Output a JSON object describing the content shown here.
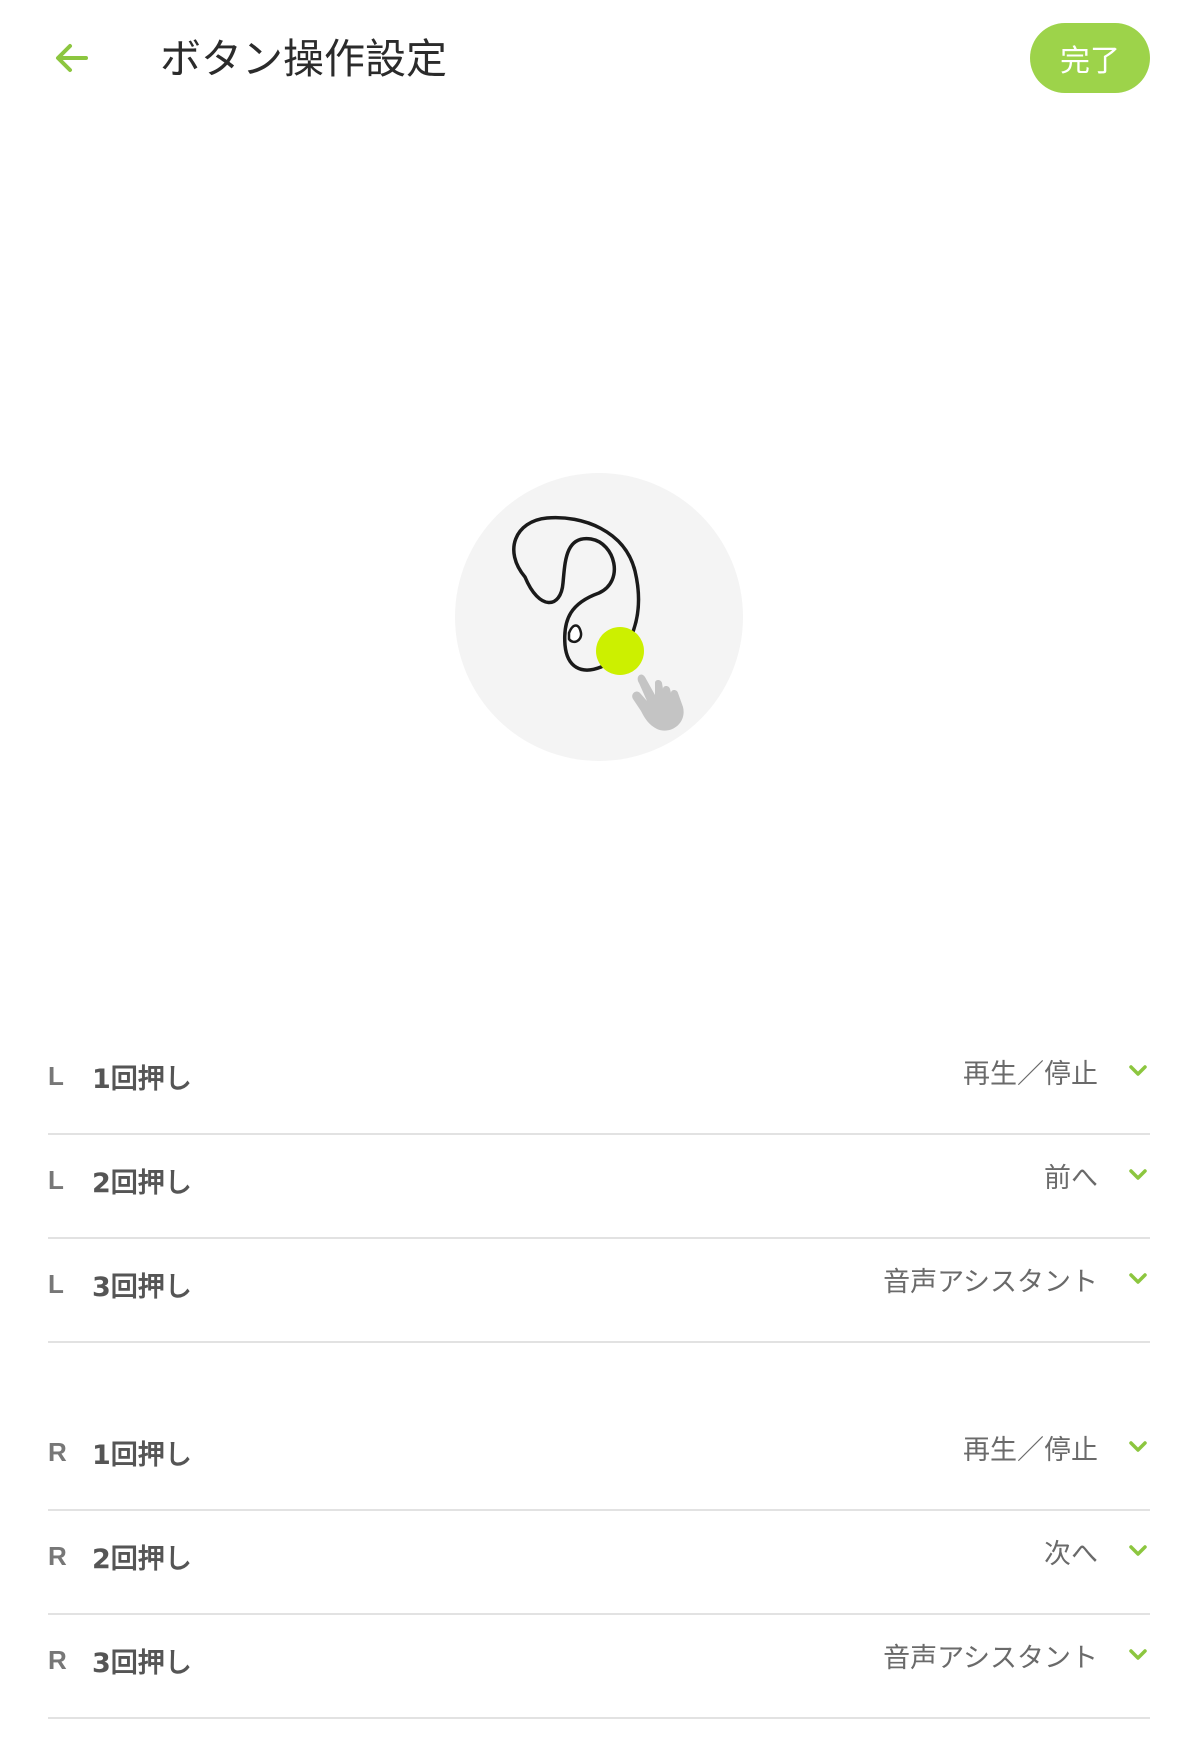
{
  "header": {
    "title": "ボタン操作設定",
    "done_label": "完了"
  },
  "colors": {
    "accent": "#9dd34a",
    "highlight_dot": "#ccf000",
    "text": "#2b2b2b",
    "divider": "#e2e2e2"
  },
  "settings": {
    "left": [
      {
        "side": "L",
        "press": "1回押し",
        "value": "再生／停止"
      },
      {
        "side": "L",
        "press": "2回押し",
        "value": "前へ"
      },
      {
        "side": "L",
        "press": "3回押し",
        "value": "音声アシスタント"
      }
    ],
    "right": [
      {
        "side": "R",
        "press": "1回押し",
        "value": "再生／停止"
      },
      {
        "side": "R",
        "press": "2回押し",
        "value": "次へ"
      },
      {
        "side": "R",
        "press": "3回押し",
        "value": "音声アシスタント"
      }
    ]
  },
  "icons": {
    "back": "arrow-left-icon",
    "dropdown": "chevron-down-icon",
    "illustration": "earbud-illustration",
    "hand": "tap-hand-icon"
  }
}
